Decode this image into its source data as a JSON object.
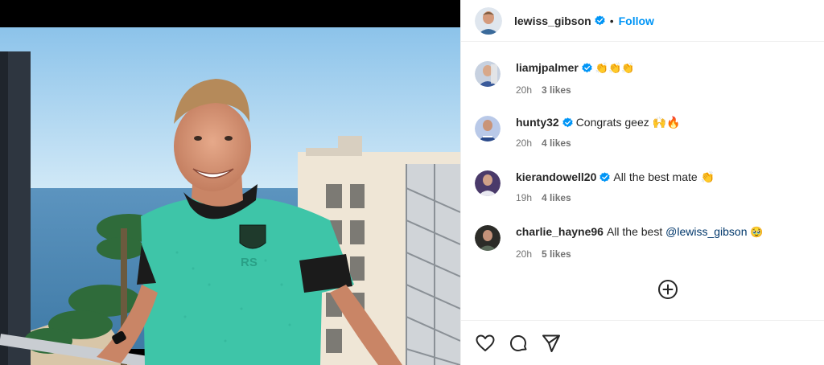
{
  "post": {
    "author": "lewiss_gibson",
    "dot": "•",
    "follow_label": "Follow"
  },
  "comments": [
    {
      "user": "liamjpalmer",
      "text": "👏👏👏",
      "time": "20h",
      "likes": "3 likes",
      "avatar_color": "#8a9bb5"
    },
    {
      "user": "hunty32",
      "text": "Congrats geez 🙌🔥",
      "time": "20h",
      "likes": "4 likes",
      "avatar_color": "#3a5aa0"
    },
    {
      "user": "kierandowell20",
      "text": "All the best mate 👏",
      "time": "19h",
      "likes": "4 likes",
      "avatar_color": "#5b3e8a"
    },
    {
      "user": "charlie_hayne96",
      "text": "All the best",
      "mention": "@lewiss_gibson",
      "emoji": "🥹",
      "time": "20h",
      "likes": "5 likes",
      "avatar_color": "#3b3b35"
    }
  ],
  "icons": {
    "verified": "verified-badge-icon",
    "load_more": "plus-circle-icon",
    "like": "heart-icon",
    "comment": "comment-bubble-icon",
    "share": "paper-plane-icon"
  },
  "colors": {
    "accent": "#0095f6",
    "verified": "#0095f6",
    "meta_text": "#737373",
    "mention": "#00376b",
    "shirt": "#3ec5a8"
  }
}
